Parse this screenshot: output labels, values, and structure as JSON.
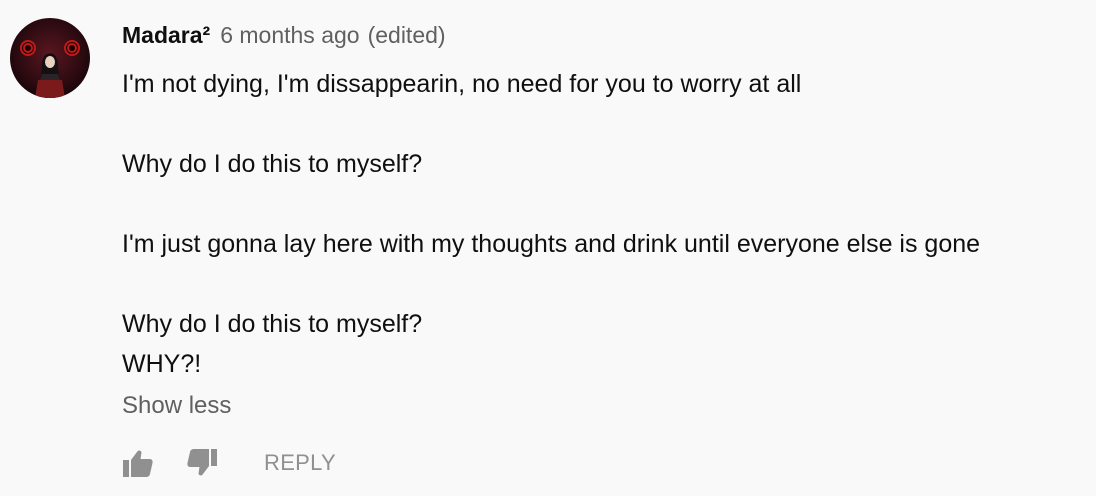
{
  "comment": {
    "author": "Madara²",
    "timestamp": "6 months ago",
    "edited_label": "(edited)",
    "lines": [
      "I'm not dying, I'm dissappearin, no need for you to worry at all",
      "",
      "Why do I do this to myself?",
      "",
      "I'm just gonna lay here with my thoughts and drink until everyone else is gone",
      "",
      "Why do I do this to myself?",
      "WHY?!"
    ],
    "show_less_label": "Show less"
  },
  "actions": {
    "like_icon": "thumbs-up-icon",
    "dislike_icon": "thumbs-down-icon",
    "reply_label": "REPLY"
  },
  "colors": {
    "background": "#f9f9f9",
    "primary_text": "#0f0f0f",
    "secondary_text": "#606060",
    "icon": "#909090"
  }
}
